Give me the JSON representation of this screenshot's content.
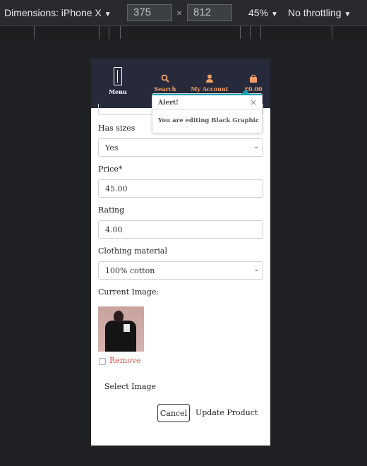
{
  "devtools": {
    "device_label": "Dimensions: iPhone X",
    "width": "375",
    "height": "812",
    "times": "×",
    "zoom": "45%",
    "throttling": "No throttling",
    "caret": "▼"
  },
  "header": {
    "menu_label": "Menu",
    "search_label": "Search",
    "account_label": "My Account",
    "bag_label": "£0.00"
  },
  "alert": {
    "title": "Alert!",
    "close": "×",
    "message": "You are editing Black Graphic"
  },
  "form": {
    "has_sizes_label": "Has sizes",
    "has_sizes_value": "Yes",
    "price_label": "Price*",
    "price_value": "45.00",
    "rating_label": "Rating",
    "rating_value": "4.00",
    "material_label": "Clothing material",
    "material_value": "100% cotton",
    "current_image_label": "Current Image:",
    "remove_label": "Remove",
    "select_image_label": "Select Image",
    "cancel_label": "Cancel",
    "update_label": "Update Product",
    "chevron": "⌄"
  },
  "colors": {
    "header_bg": "#262a3a",
    "accent_orange": "#f29f67",
    "remove_red": "#d9534f",
    "alert_accent": "#17a2b8"
  },
  "icons": {
    "search": "search-icon",
    "account": "user-icon",
    "bag": "shopping-bag-icon",
    "menu": "menu-logo-icon"
  }
}
